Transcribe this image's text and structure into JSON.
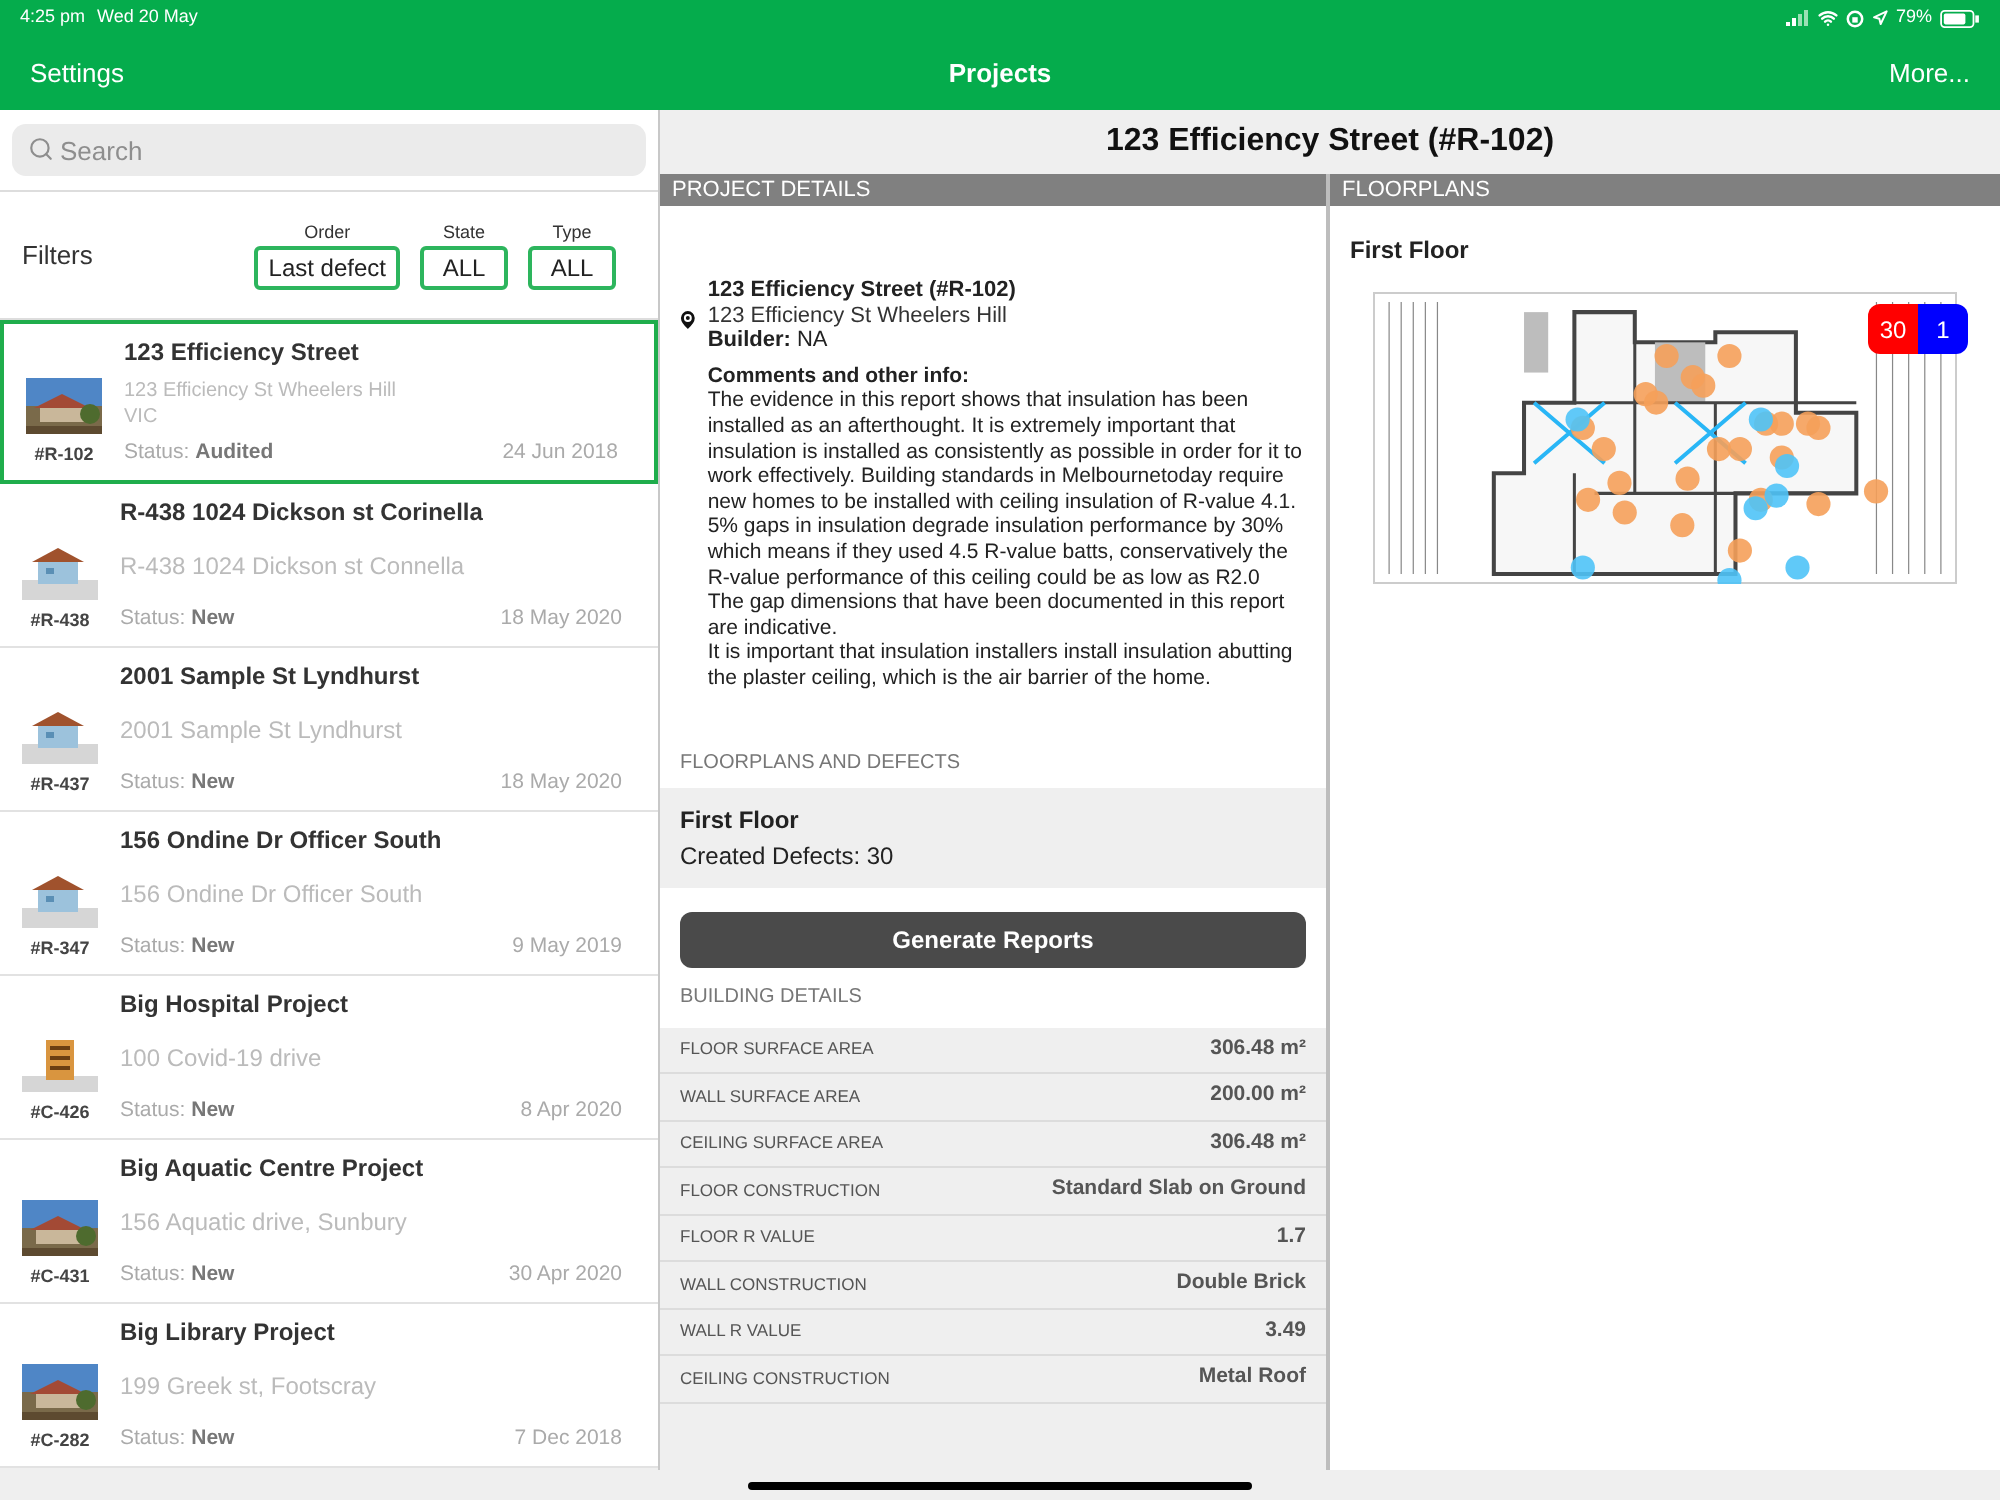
{
  "status_bar": {
    "time": "4:25 pm",
    "date": "Wed 20 May",
    "battery": "79%"
  },
  "nav": {
    "left": "Settings",
    "title": "Projects",
    "right": "More..."
  },
  "search": {
    "placeholder": "Search"
  },
  "filters": {
    "label": "Filters",
    "items": [
      {
        "caption": "Order",
        "value": "Last defect"
      },
      {
        "caption": "State",
        "value": "ALL"
      },
      {
        "caption": "Type",
        "value": "ALL"
      }
    ]
  },
  "projects": [
    {
      "title": "123 Efficiency Street",
      "address": [
        "123 Efficiency St Wheelers Hill",
        "VIC"
      ],
      "code": "#R-102",
      "status": "Status: **Audited**",
      "date": "24 Jun 2018",
      "selected": true
    },
    {
      "title": "R-438 1024 Dickson st Corinella",
      "address": [
        "R-438 1024 Dickson st Connella"
      ],
      "code": "#R-438",
      "status": "Status: **New**",
      "date": "18 May 2020",
      "selected": false,
      "kind": "house"
    },
    {
      "title": "2001 Sample St Lyndhurst",
      "address": [
        "2001 Sample St Lyndhurst"
      ],
      "code": "#R-437",
      "status": "Status: **New**",
      "date": "18 May 2020",
      "selected": false,
      "kind": "house"
    },
    {
      "title": "156 Ondine Dr Officer South",
      "address": [
        "156 Ondine Dr Officer South"
      ],
      "code": "#R-347",
      "status": "Status: **New**",
      "date": "9 May 2019",
      "selected": false,
      "kind": "house"
    },
    {
      "title": "Big Hospital Project",
      "address": [
        "100 Covid-19 drive"
      ],
      "code": "#C-426",
      "status": "Status: **New**",
      "date": "8 Apr 2020",
      "selected": false,
      "kind": "building"
    },
    {
      "title": "Big Aquatic Centre Project",
      "address": [
        "156 Aquatic drive, Sunbury"
      ],
      "code": "#C-431",
      "status": "Status: **New**",
      "date": "30 Apr 2020",
      "selected": false
    },
    {
      "title": "Big Library Project",
      "address": [
        "199 Greek st, Footscray"
      ],
      "code": "#C-282",
      "status": "Status: **New**",
      "date": "7 Dec 2018",
      "selected": false
    }
  ],
  "detail": {
    "title": "123 Efficiency Street (#R-102)",
    "section": "PROJECT DETAILS",
    "name": "123 Efficiency Street (#R-102)",
    "address": "123 Efficiency St Wheelers Hill",
    "builder": "**Builder:** NA",
    "comments_heading": "Comments and other info:",
    "comments": [
      "The evidence in this report shows that insulation has been installed as an afterthought.  It is extremely important that insulation is installed as consistently as possible in order for it to work effectively.  Building standards in Melbournetoday require new homes to be installed with ceiling insulation of R-value 4.1.",
      "5% gaps in insulation degrade insulation performance by 30% which means if they used 4.5 R-value batts, conservatively the R-value performance of this ceiling could be as low as R2.0",
      "The gap dimensions that have been documented in this report are indicative.",
      "It is important that insulation installers install insulation abutting the plaster ceiling, which is the air barrier of the home."
    ],
    "floorplans_header": "FLOORPLANS AND DEFECTS",
    "floor": {
      "name": "First Floor",
      "defects": "Created Defects: 30"
    },
    "button": "Generate Reports",
    "building_header": "BUILDING DETAILS",
    "building": [
      {
        "label": "FLOOR SURFACE AREA",
        "value": "306.48 m²"
      },
      {
        "label": "WALL SURFACE AREA",
        "value": "200.00 m²"
      },
      {
        "label": "CEILING SURFACE AREA",
        "value": "306.48 m²"
      },
      {
        "label": "FLOOR CONSTRUCTION",
        "value": "Standard Slab on Ground"
      },
      {
        "label": "FLOOR R VALUE",
        "value": "1.7"
      },
      {
        "label": "WALL CONSTRUCTION",
        "value": "Double Brick"
      },
      {
        "label": "WALL R VALUE",
        "value": "3.49"
      },
      {
        "label": "CEILING CONSTRUCTION",
        "value": "Metal Roof"
      }
    ]
  },
  "floorplans": {
    "section": "FLOORPLANS",
    "title": "First Floor",
    "badges": [
      {
        "count": "30",
        "color": "#ff0000"
      },
      {
        "count": "1",
        "color": "#0000ff"
      }
    ]
  }
}
